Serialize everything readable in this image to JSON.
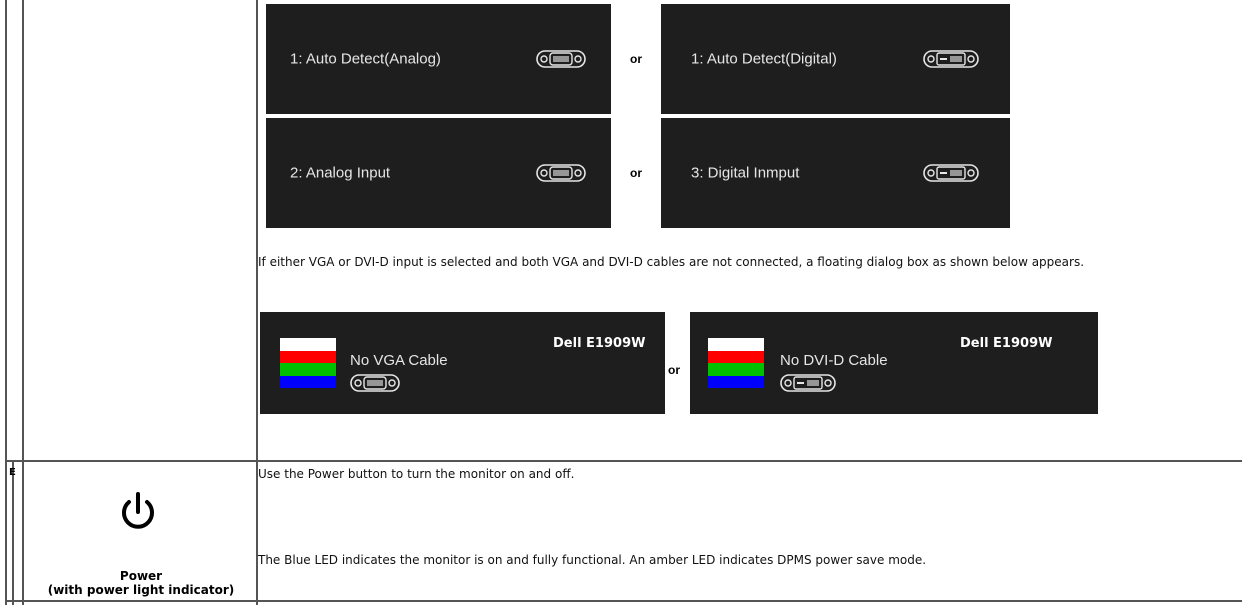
{
  "osd_screens": [
    {
      "label": "1: Auto Detect(Analog)",
      "connector": "vga-connector-icon"
    },
    {
      "label": "1: Auto Detect(Digital)",
      "connector": "dvi-connector-icon"
    },
    {
      "label": "2: Analog Input",
      "connector": "vga-connector-icon"
    },
    {
      "label": "3: Digital Inmput",
      "connector": "dvi-connector-icon"
    }
  ],
  "separator_or": "or",
  "paragraph_floating": "If either VGA or DVI-D input is selected and both VGA and DVI-D cables are not connected, a floating dialog box as shown below appears.",
  "dialogs": [
    {
      "message": "No VGA Cable",
      "brand": "Dell E1909W",
      "connector": "vga-connector-icon"
    },
    {
      "message": "No DVI-D Cable",
      "brand": "Dell E1909W",
      "connector": "dvi-connector-icon"
    }
  ],
  "color_bars": [
    "#ffffff",
    "#ff0000",
    "#00c000",
    "#0000ff"
  ],
  "row_e": {
    "letter": "E",
    "icon": "power-icon",
    "label_line1": "Power",
    "label_line2": "(with power light indicator)",
    "desc1": "Use the Power button to turn the monitor on and off.",
    "desc2": "The Blue LED indicates the monitor is on and fully functional. An amber LED indicates DPMS power save mode."
  }
}
